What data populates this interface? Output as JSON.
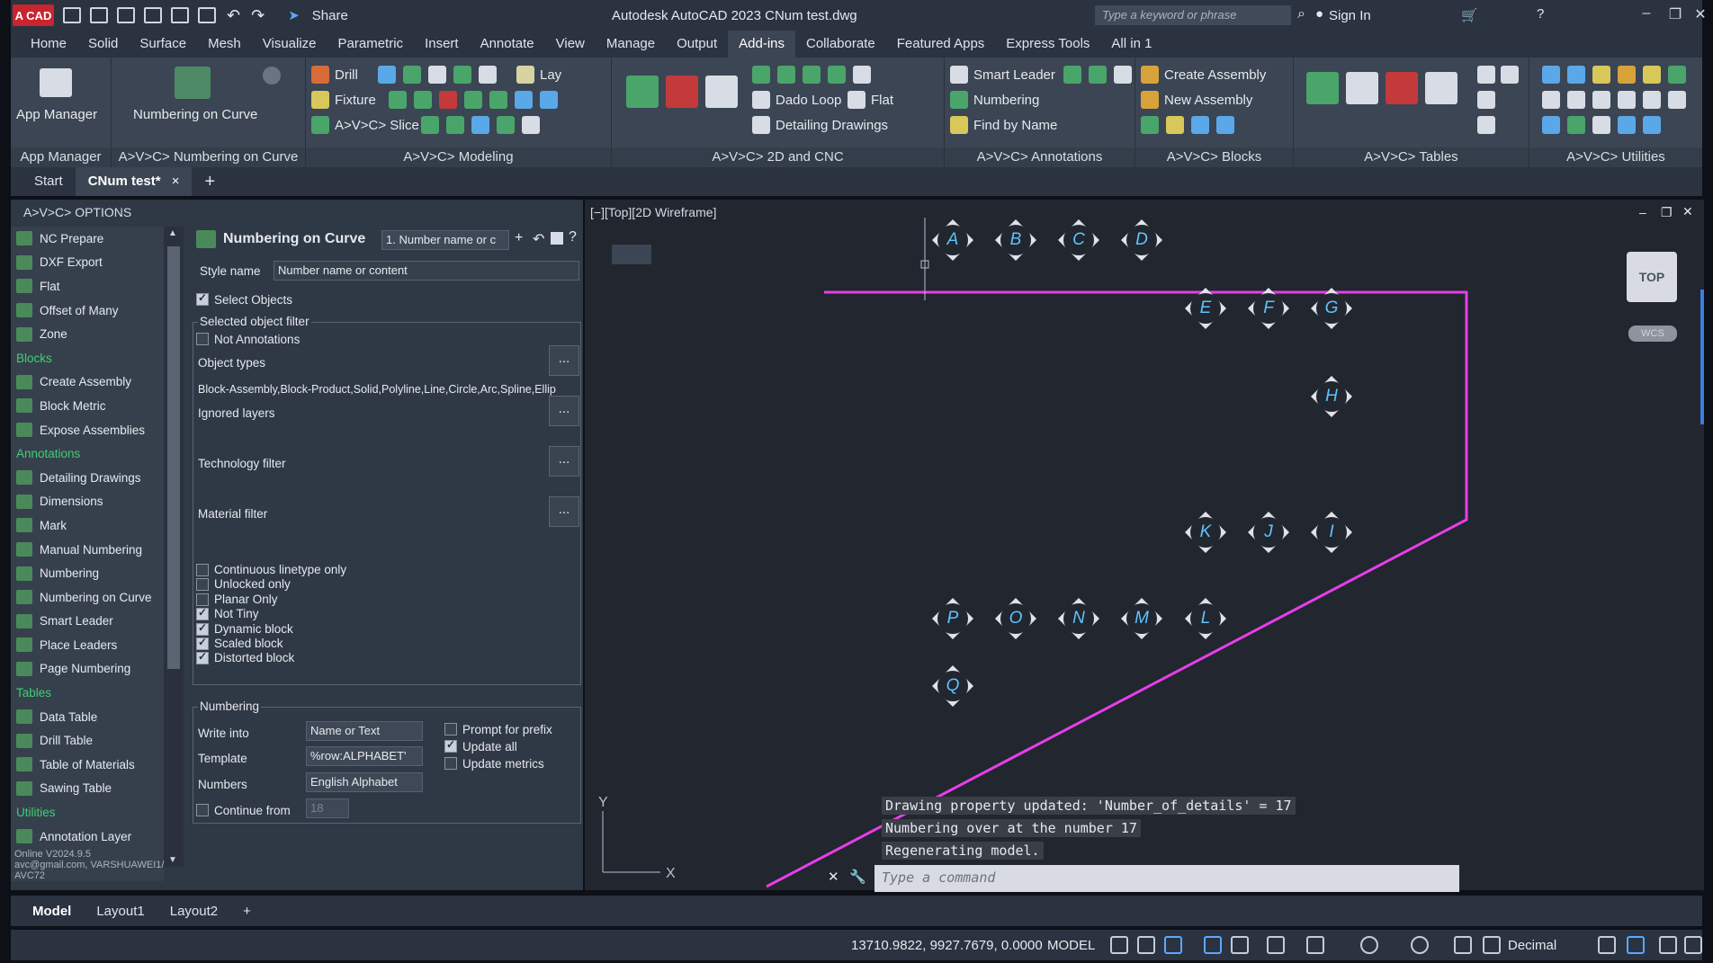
{
  "titlebar": {
    "logo": "A CAD",
    "share": "Share",
    "app_title": "Autodesk AutoCAD 2023    CNum test.dwg",
    "search_placeholder": "Type a keyword or phrase",
    "sign_in": "Sign In"
  },
  "ribbon_tabs": [
    "Home",
    "Solid",
    "Surface",
    "Mesh",
    "Visualize",
    "Parametric",
    "Insert",
    "Annotate",
    "View",
    "Manage",
    "Output",
    "Add-ins",
    "Collaborate",
    "Featured Apps",
    "Express Tools",
    "All in 1"
  ],
  "ribbon": {
    "app_manager": "App Manager",
    "numbering_on_curve": "Numbering on Curve",
    "drill": "Drill",
    "lay": "Lay",
    "fixture": "Fixture",
    "slice": "A>V>C> Slice",
    "dado_loop": "Dado Loop",
    "flat": "Flat",
    "detailing_drawings": "Detailing Drawings",
    "smart_leader": "Smart Leader",
    "numbering": "Numbering",
    "find_by_name": "Find by Name",
    "create_assembly": "Create Assembly",
    "new_assembly": "New Assembly",
    "panels": [
      "App Manager",
      "A>V>C> Numbering on Curve",
      "A>V>C> Modeling",
      "A>V>C> 2D and CNC",
      "A>V>C> Annotations",
      "A>V>C> Blocks",
      "A>V>C> Tables",
      "A>V>C> Utilities"
    ]
  },
  "doc_tabs": {
    "start": "Start",
    "active": "CNum test*",
    "close": "×",
    "add": "+"
  },
  "palette": {
    "title": "A>V>C> OPTIONS",
    "items": [
      {
        "type": "item",
        "label": "NC Prepare"
      },
      {
        "type": "item",
        "label": "DXF Export"
      },
      {
        "type": "item",
        "label": "Flat"
      },
      {
        "type": "item",
        "label": "Offset of Many"
      },
      {
        "type": "item",
        "label": "Zone"
      },
      {
        "type": "cat",
        "label": "Blocks"
      },
      {
        "type": "item",
        "label": "Create Assembly"
      },
      {
        "type": "item",
        "label": "Block Metric"
      },
      {
        "type": "item",
        "label": "Expose Assemblies"
      },
      {
        "type": "cat",
        "label": "Annotations"
      },
      {
        "type": "item",
        "label": "Detailing Drawings"
      },
      {
        "type": "item",
        "label": "Dimensions"
      },
      {
        "type": "item",
        "label": "Mark"
      },
      {
        "type": "item",
        "label": "Manual Numbering"
      },
      {
        "type": "item",
        "label": "Numbering"
      },
      {
        "type": "item",
        "label": "Numbering on Curve"
      },
      {
        "type": "item",
        "label": "Smart Leader"
      },
      {
        "type": "item",
        "label": "Place Leaders"
      },
      {
        "type": "item",
        "label": "Page Numbering"
      },
      {
        "type": "cat",
        "label": "Tables"
      },
      {
        "type": "item",
        "label": "Data Table"
      },
      {
        "type": "item",
        "label": "Drill Table"
      },
      {
        "type": "item",
        "label": "Table of Materials"
      },
      {
        "type": "item",
        "label": "Sawing Table"
      },
      {
        "type": "cat",
        "label": "Utilities"
      },
      {
        "type": "item",
        "label": "Annotation Layer"
      }
    ],
    "footer": [
      "Online V2024.9.5",
      "avc@gmail.com, VARSHUAWEI1/",
      "AVC72"
    ]
  },
  "options": {
    "header": "Numbering on Curve",
    "style_dropdown": "1. Number name or c",
    "style_name_label": "Style name",
    "style_name_value": "Number name or content",
    "select_objects": "Select Objects",
    "filter_group": "Selected object filter",
    "not_annotations": "Not Annotations",
    "object_types": "Object types",
    "object_types_value": "Block-Assembly,Block-Product,Solid,Polyline,Line,Circle,Arc,Spline,Ellip",
    "ignored_layers": "Ignored layers",
    "technology_filter": "Technology filter",
    "material_filter": "Material filter",
    "dots": "...",
    "checks": [
      {
        "label": "Continuous linetype only",
        "on": false
      },
      {
        "label": "Unlocked only",
        "on": false
      },
      {
        "label": "Planar Only",
        "on": false
      },
      {
        "label": "Not Tiny",
        "on": true
      },
      {
        "label": "Dynamic block",
        "on": true
      },
      {
        "label": "Scaled block",
        "on": true
      },
      {
        "label": "Distorted block",
        "on": true
      }
    ],
    "numbering_group": "Numbering",
    "write_into_label": "Write into",
    "write_into_value": "Name or Text",
    "template_label": "Template",
    "template_value": "%row:ALPHABET'",
    "numbers_label": "Numbers",
    "numbers_value": "English Alphabet",
    "continue_from_label": "Continue from",
    "continue_from_value": "18",
    "prompt_prefix": "Prompt for prefix",
    "update_all": "Update all",
    "update_metrics": "Update metrics"
  },
  "viewport": {
    "label": "[−][Top][2D Wireframe]",
    "viewcube": "TOP",
    "wcs": "WCS",
    "markers": [
      "A",
      "B",
      "C",
      "D",
      "E",
      "F",
      "G",
      "H",
      "I",
      "J",
      "K",
      "L",
      "M",
      "N",
      "O",
      "P",
      "Q"
    ],
    "axis_y": "Y",
    "axis_x": "X",
    "history": [
      "Drawing property updated: 'Number_of_details' = 17",
      "Numbering over at the number 17",
      "Regenerating model."
    ],
    "command_placeholder": "Type a command",
    "colors": {
      "polyline": "#e83ee8",
      "marker_text": "#5ec4ff"
    }
  },
  "layout_tabs": [
    "Model",
    "Layout1",
    "Layout2",
    "+"
  ],
  "status": {
    "coords": "13710.9822, 9927.7679, 0.0000",
    "model": "MODEL",
    "units": "Decimal"
  }
}
